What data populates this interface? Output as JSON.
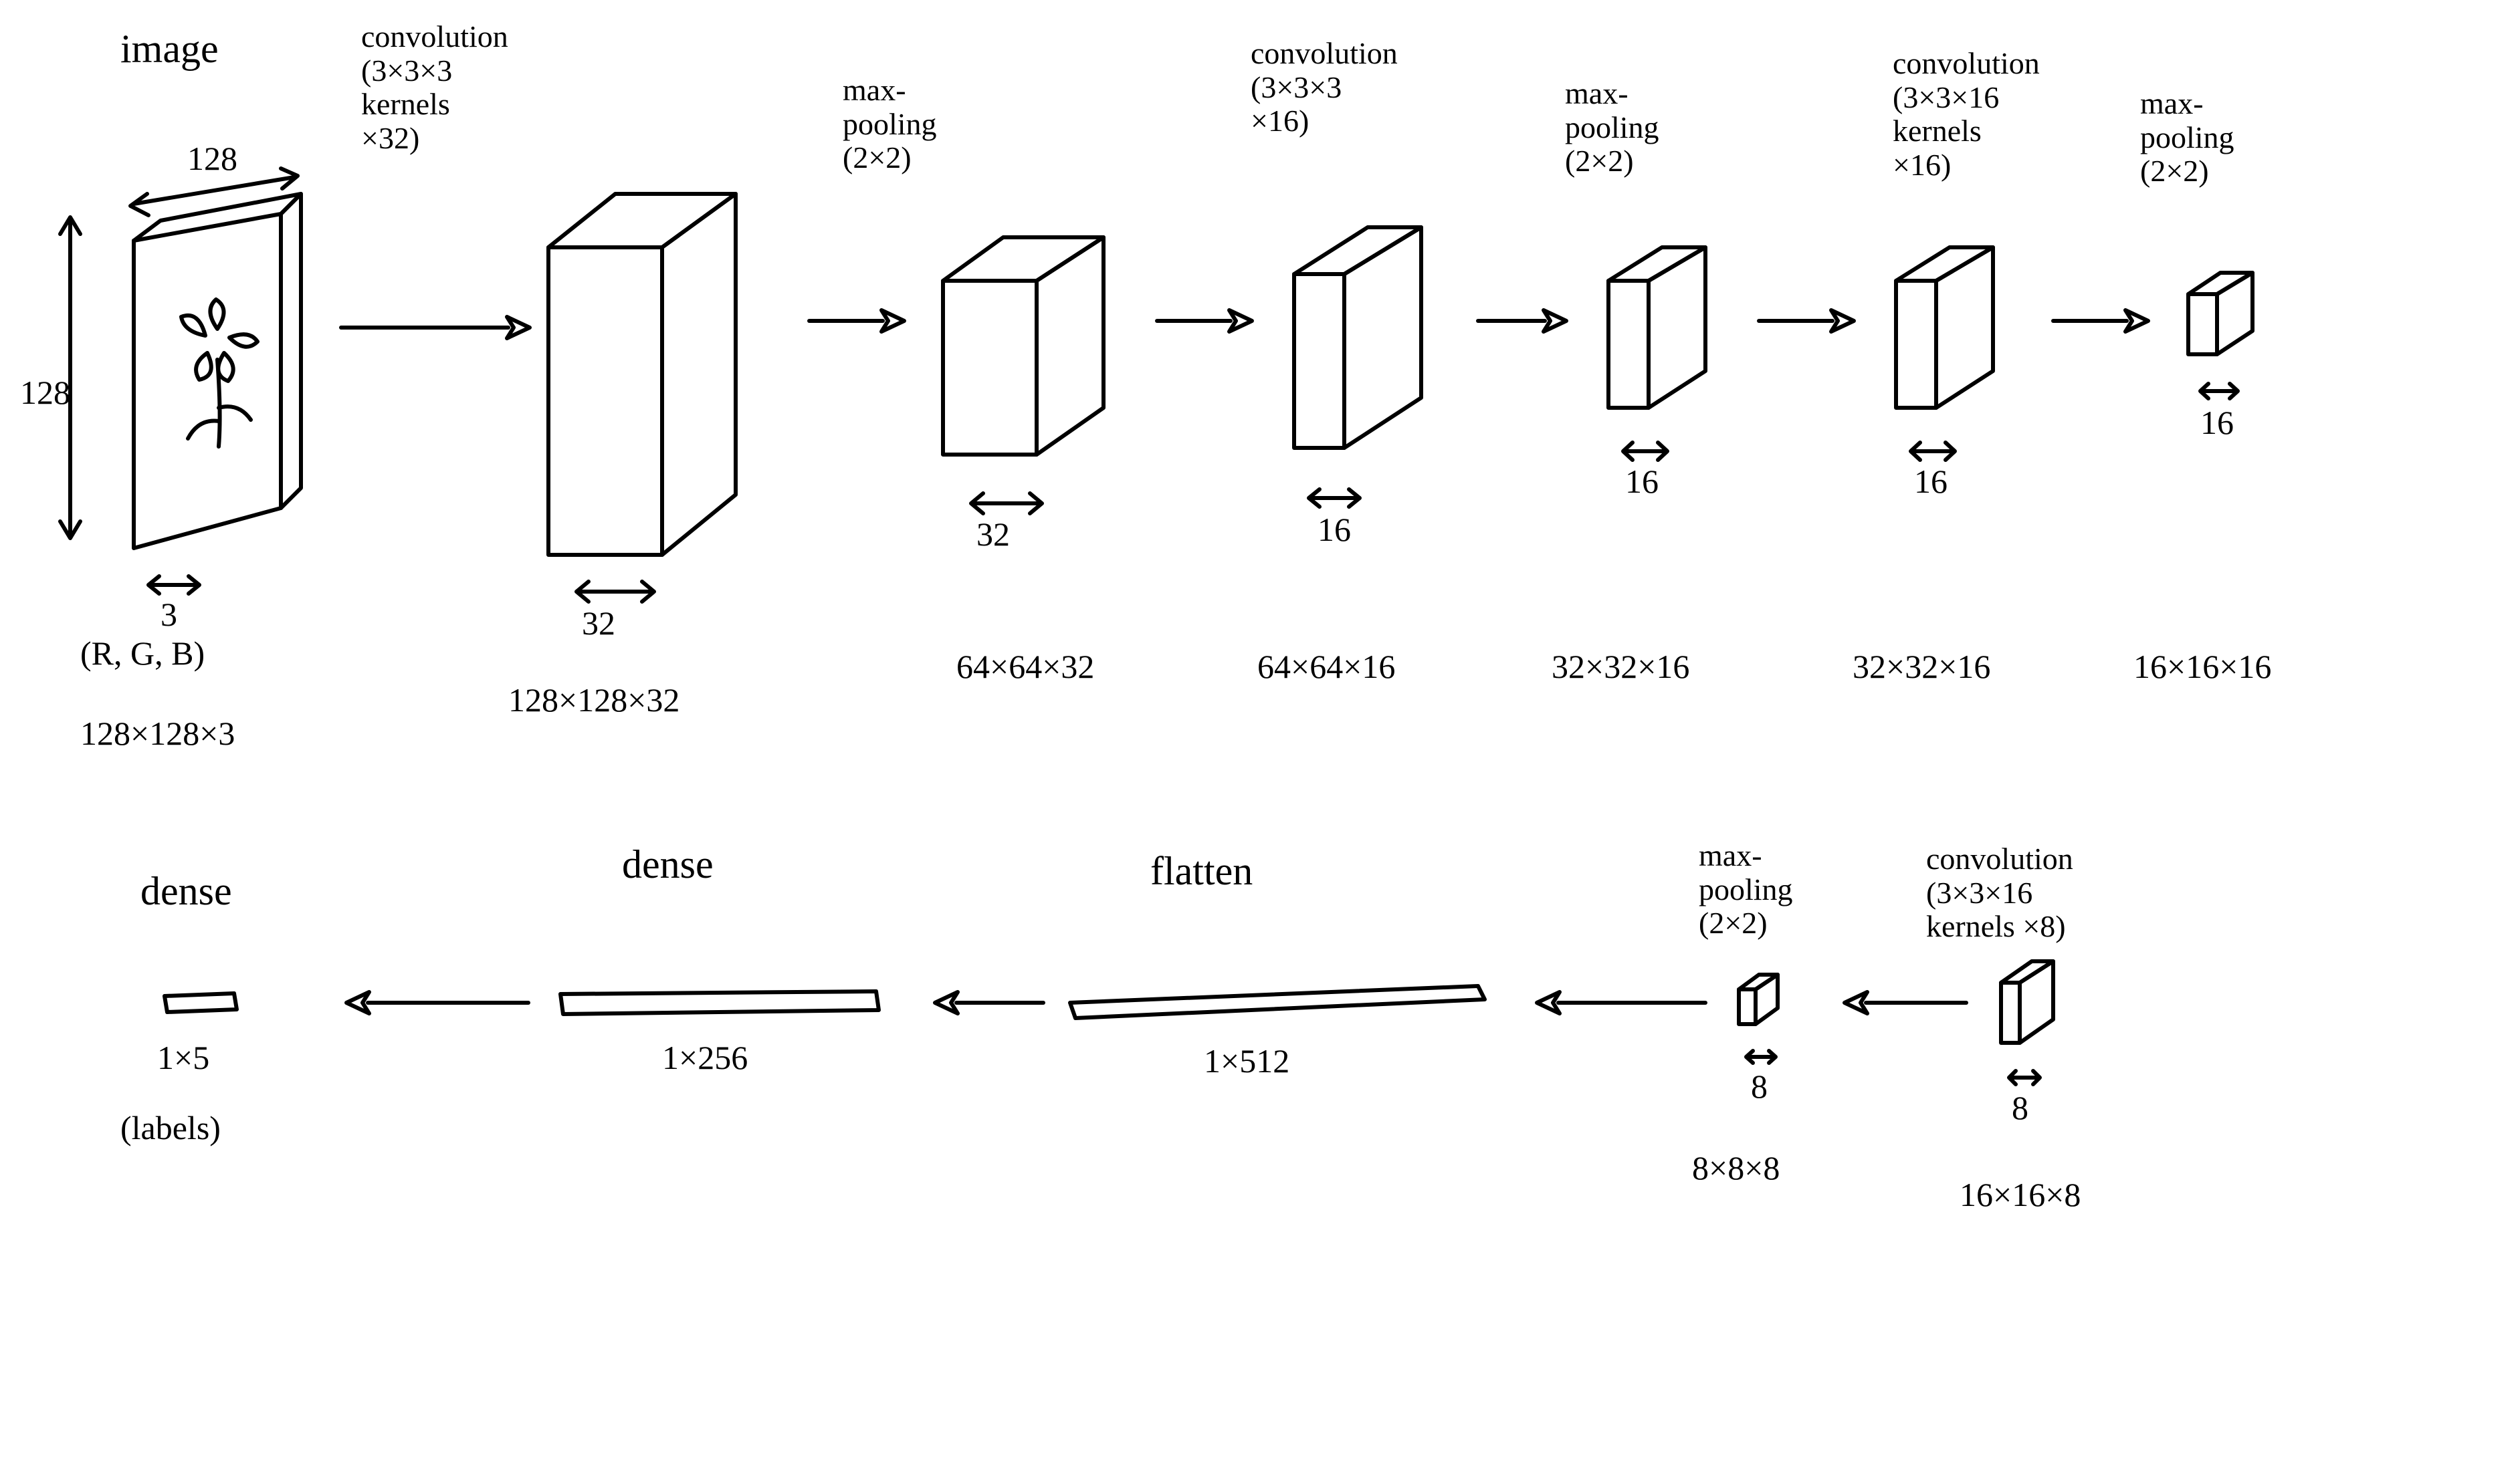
{
  "layers": {
    "image": {
      "title": "image",
      "h_dim": "128",
      "w_dim": "128",
      "d_dim": "3",
      "channels_note": "(R, G, B)",
      "shape": "128×128×3"
    },
    "conv1": {
      "title": "convolution\n(3×3×3\nkernels\n×32)",
      "d_dim": "32",
      "shape": "128×128×32"
    },
    "pool1": {
      "title": "max-\npooling\n(2×2)",
      "d_dim": "32",
      "shape": "64×64×32"
    },
    "conv2": {
      "title": "convolution\n(3×3×3\n×16)",
      "d_dim": "16",
      "shape": "64×64×16"
    },
    "pool2": {
      "title": "max-\npooling\n(2×2)",
      "d_dim": "16",
      "shape": "32×32×16"
    },
    "conv3": {
      "title": "convolution\n(3×3×16\nkernels\n×16)",
      "d_dim": "16",
      "shape": "32×32×16"
    },
    "pool3": {
      "title": "max-\npooling\n(2×2)",
      "d_dim": "16",
      "shape": "16×16×16"
    },
    "conv4": {
      "title": "convolution\n(3×3×16\nkernels ×8)",
      "d_dim": "8",
      "shape": "16×16×8"
    },
    "pool4": {
      "title": "max-\npooling\n(2×2)",
      "d_dim": "8",
      "shape": "8×8×8"
    },
    "flatten": {
      "title": "flatten",
      "shape": "1×512"
    },
    "dense1": {
      "title": "dense",
      "shape": "1×256"
    },
    "dense2": {
      "title": "dense",
      "shape": "1×5",
      "note": "(labels)"
    }
  }
}
